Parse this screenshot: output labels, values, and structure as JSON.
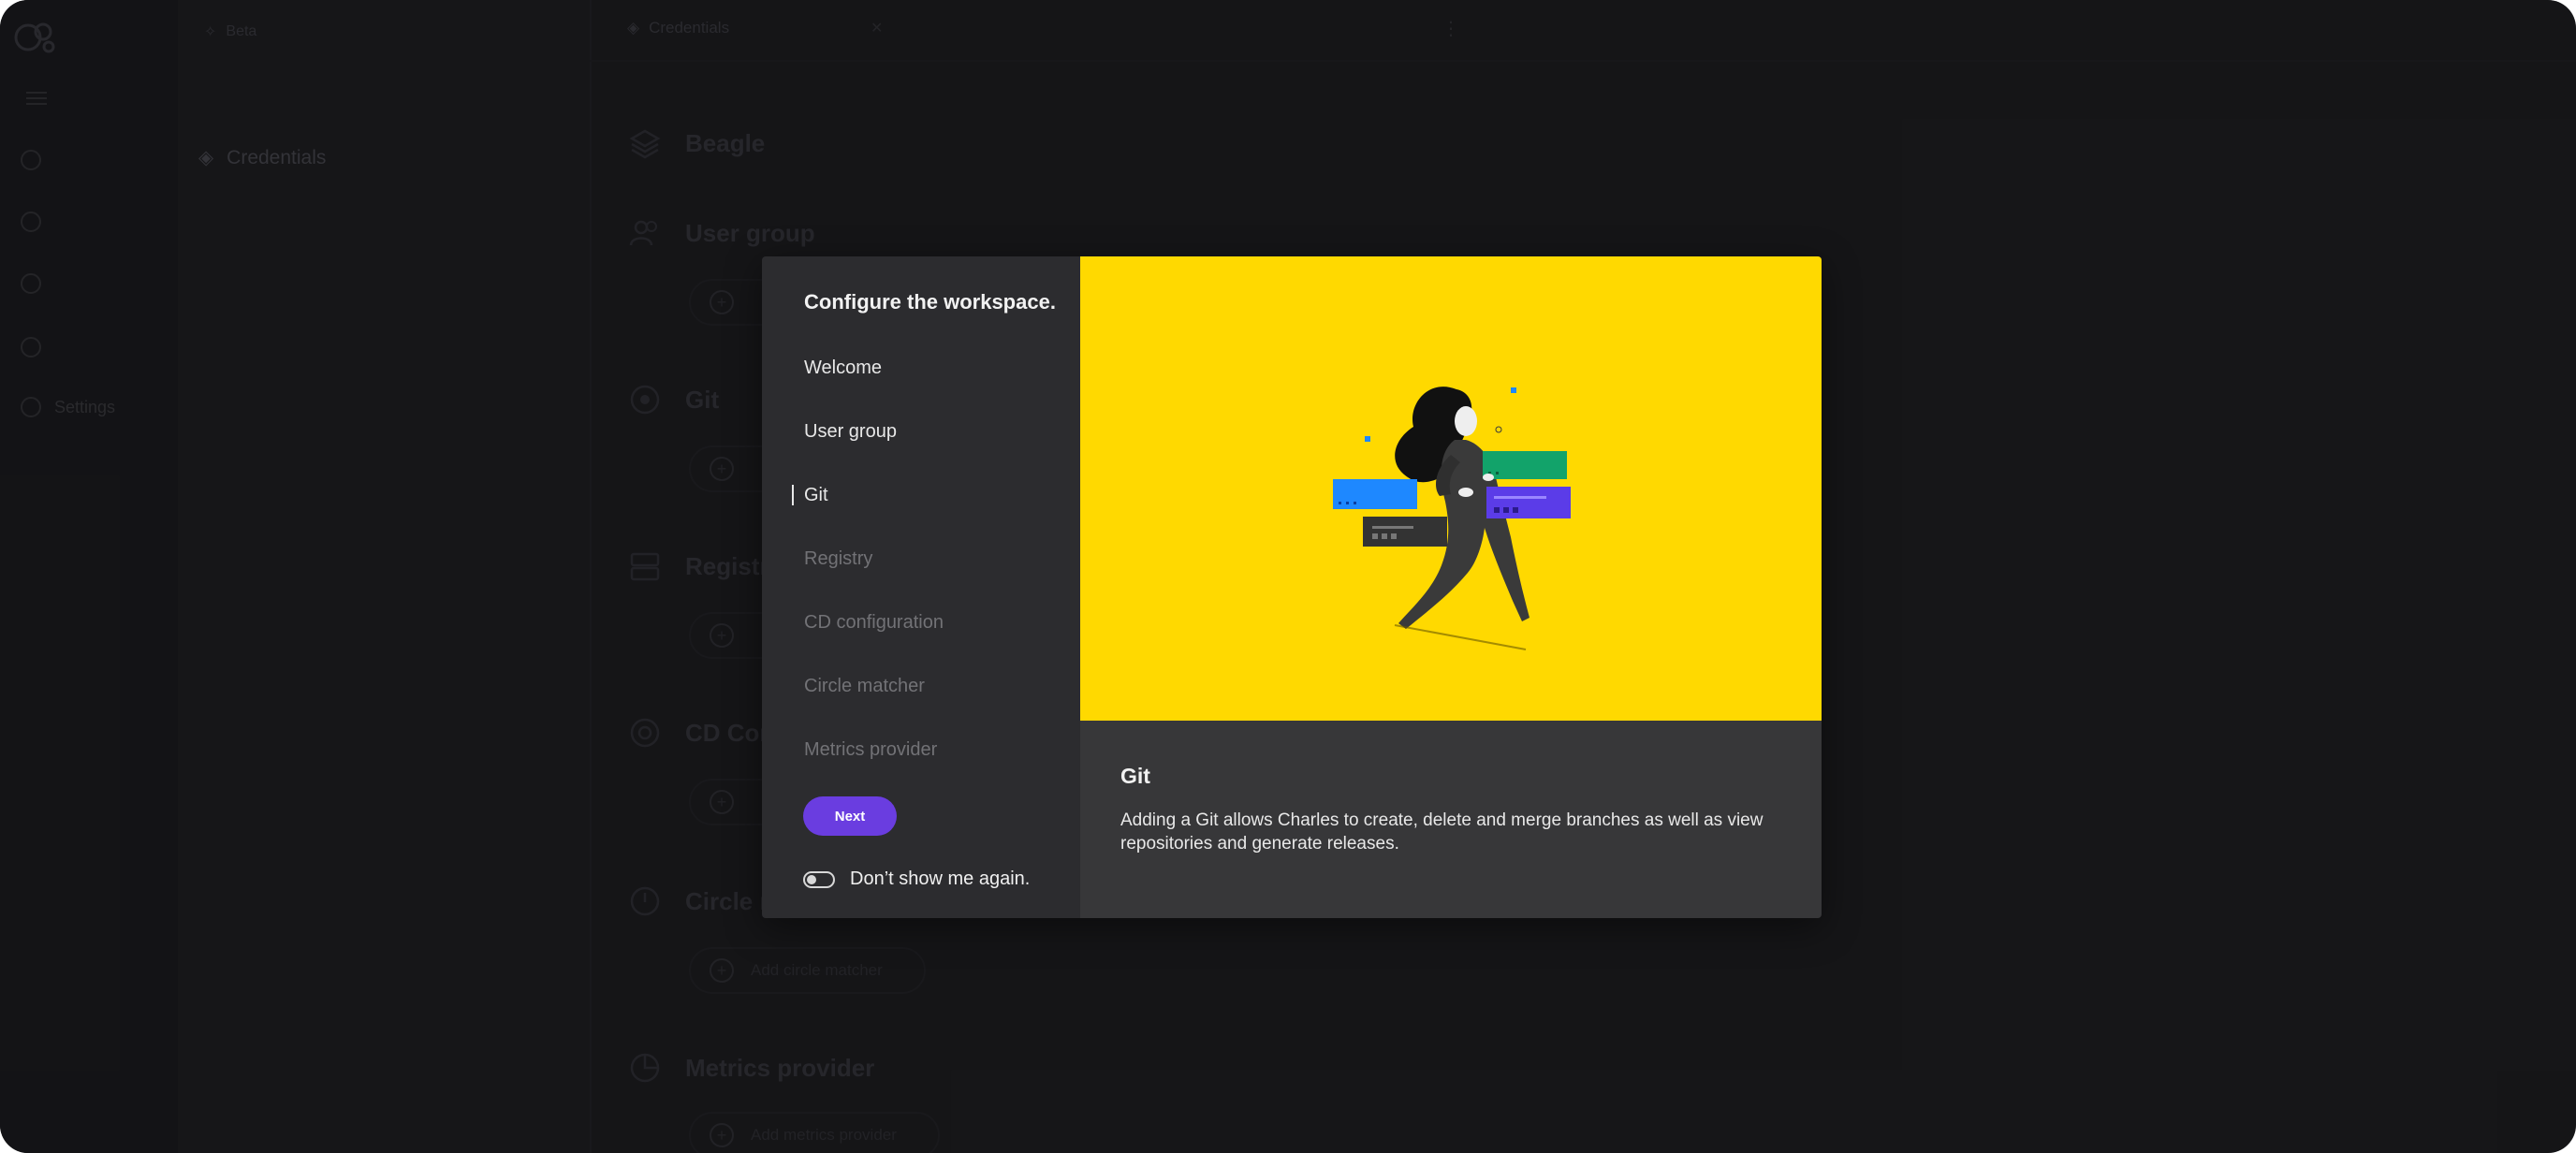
{
  "background": {
    "sidebar": {
      "items": [
        "",
        "",
        "",
        "",
        "",
        ""
      ],
      "settings_label": "Settings"
    },
    "breadcrumb": "Beta",
    "list_item": "Credentials",
    "tab": "Credentials",
    "workspace_name": "Beagle",
    "sections": [
      {
        "title": "User group",
        "add_label": ""
      },
      {
        "title": "Git",
        "add_label": ""
      },
      {
        "title": "Registry",
        "add_label": ""
      },
      {
        "title": "CD Configuration",
        "add_label": ""
      },
      {
        "title": "Circle matcher",
        "add_label": "Add circle matcher"
      },
      {
        "title": "Metrics provider",
        "add_label": "Add metrics provider"
      }
    ]
  },
  "modal": {
    "title": "Configure the workspace.",
    "steps": [
      {
        "label": "Welcome",
        "state": "done"
      },
      {
        "label": "User group",
        "state": "done"
      },
      {
        "label": "Git",
        "state": "active"
      },
      {
        "label": "Registry",
        "state": "todo"
      },
      {
        "label": "CD configuration",
        "state": "todo"
      },
      {
        "label": "Circle matcher",
        "state": "todo"
      },
      {
        "label": "Metrics provider",
        "state": "todo"
      }
    ],
    "next_label": "Next",
    "dont_show_label": "Don’t show me again.",
    "dont_show_enabled": false,
    "info_title": "Git",
    "info_text": "Adding a Git allows Charles to create, delete and merge branches as well as view repositories and generate releases.",
    "colors": {
      "hero_background": "#ffd900",
      "accent": "#6a3de0",
      "panel_left": "#2c2c2f",
      "panel_right": "#373739"
    }
  }
}
